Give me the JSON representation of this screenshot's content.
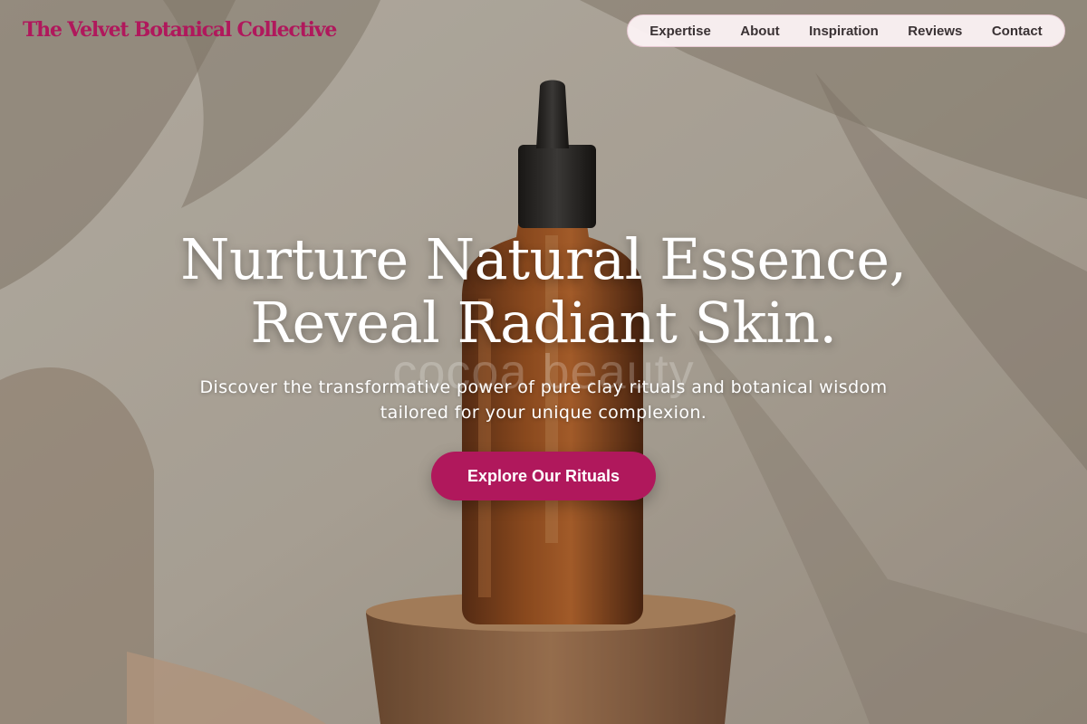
{
  "brand": {
    "name": "The Velvet Botanical Collective"
  },
  "nav": {
    "items": [
      {
        "label": "Expertise"
      },
      {
        "label": "About"
      },
      {
        "label": "Inspiration"
      },
      {
        "label": "Reviews"
      },
      {
        "label": "Contact"
      }
    ]
  },
  "hero": {
    "headline_line1": "Nurture Natural Essence,",
    "headline_line2": "Reveal Radiant Skin.",
    "watermark": "cocoa beauty",
    "subtext": "Discover the transformative power of pure clay rituals and botanical wisdom tailored for your unique complexion.",
    "cta_label": "Explore Our Rituals",
    "image": "amber-dropper-bottle-on-wooden-pedestal"
  },
  "colors": {
    "accent": "#b0185c",
    "nav_bg": "#fff5f7",
    "nav_text": "#3a3234",
    "headline": "#ffffff"
  }
}
